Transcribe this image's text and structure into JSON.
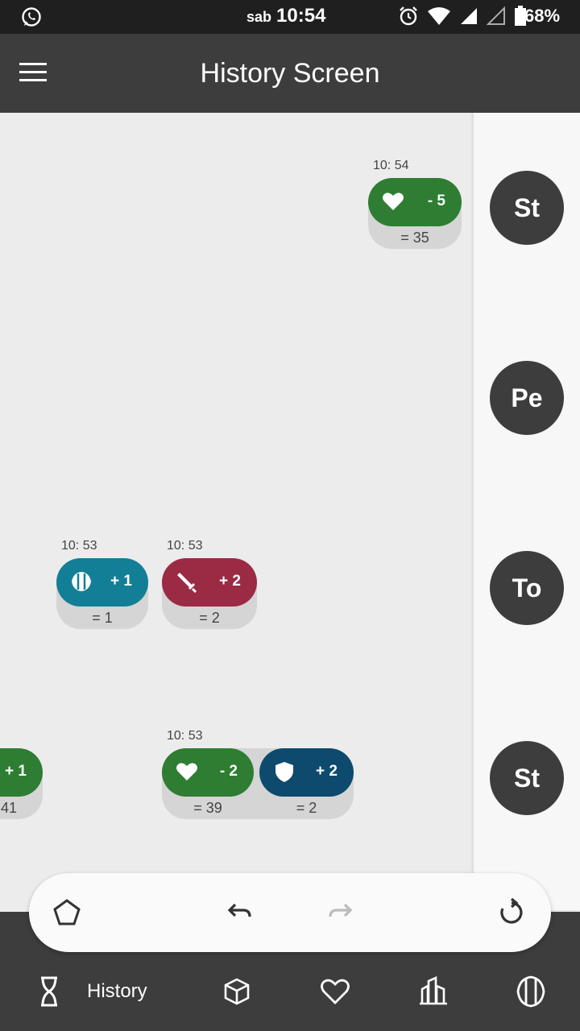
{
  "status_bar": {
    "day": "sab",
    "time": "10:54",
    "battery": "68%"
  },
  "app_bar": {
    "title": "History Screen"
  },
  "timeline": {
    "groups": [
      {
        "time": "10: 54",
        "events": [
          {
            "icon": "heart-icon",
            "delta": "- 5",
            "result": "= 35",
            "color": "#2e7d32"
          }
        ]
      },
      {
        "time": "10: 53",
        "events": [
          {
            "icon": "experience-icon",
            "delta": "+ 1",
            "result": "= 1",
            "color": "#127f96"
          }
        ]
      },
      {
        "time": "10: 53",
        "events": [
          {
            "icon": "sword-icon",
            "delta": "+ 2",
            "result": "= 2",
            "color": "#9b2a45"
          }
        ]
      },
      {
        "events": [
          {
            "icon": "heart-icon",
            "delta": "+ 1",
            "result": "41",
            "color": "#2e7d32"
          }
        ]
      },
      {
        "time": "10: 53",
        "events": [
          {
            "icon": "heart-icon",
            "delta": "- 2",
            "result": "= 39",
            "color": "#2e7d32"
          },
          {
            "icon": "shield-icon",
            "delta": "+ 2",
            "result": "= 2",
            "color": "#0d4a6e"
          }
        ]
      }
    ]
  },
  "players": [
    "St",
    "Pe",
    "To",
    "St"
  ],
  "bottom_nav": {
    "active_label": "History"
  },
  "colors": {
    "app_bar": "#3d3d3d",
    "status_bar": "#1f1f1f"
  }
}
